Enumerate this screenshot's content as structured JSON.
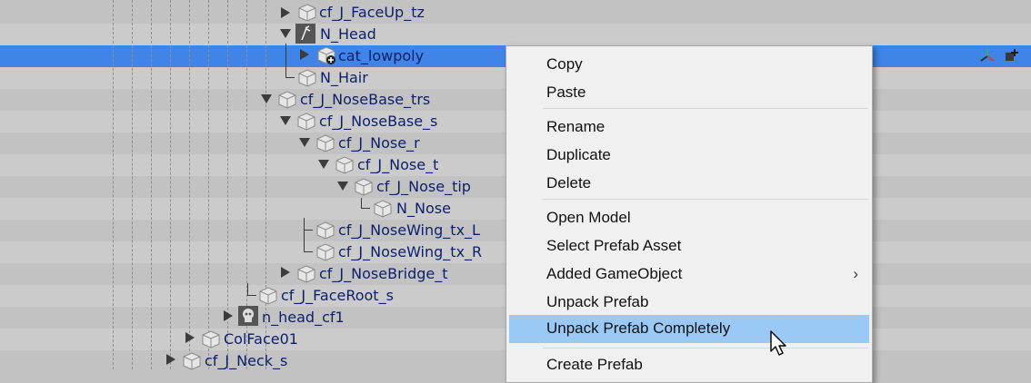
{
  "hierarchy": {
    "items": [
      {
        "label": "cf_J_FaceUp_tz"
      },
      {
        "label": "N_Head"
      },
      {
        "label": "cat_lowpoly"
      },
      {
        "label": "N_Hair"
      },
      {
        "label": "cf_J_NoseBase_trs"
      },
      {
        "label": "cf_J_NoseBase_s"
      },
      {
        "label": "cf_J_Nose_r"
      },
      {
        "label": "cf_J_Nose_t"
      },
      {
        "label": "cf_J_Nose_tip"
      },
      {
        "label": "N_Nose"
      },
      {
        "label": "cf_J_NoseWing_tx_L"
      },
      {
        "label": "cf_J_NoseWing_tx_R"
      },
      {
        "label": "cf_J_NoseBridge_t"
      },
      {
        "label": "cf_J_FaceRoot_s"
      },
      {
        "label": "n_head_cf1"
      },
      {
        "label": "ColFace01"
      },
      {
        "label": "cf_J_Neck_s"
      }
    ],
    "selected_item": "cat_lowpoly"
  },
  "context_menu": {
    "items": [
      {
        "label": "Copy"
      },
      {
        "label": "Paste"
      },
      {
        "label": "Rename"
      },
      {
        "label": "Duplicate"
      },
      {
        "label": "Delete"
      },
      {
        "label": "Open Model"
      },
      {
        "label": "Select Prefab Asset"
      },
      {
        "label": "Added GameObject",
        "submenu_icon": "chevron-right-icon"
      },
      {
        "label": "Unpack Prefab"
      },
      {
        "label": "Unpack Prefab Completely",
        "highlighted": true
      },
      {
        "label": "Create Prefab"
      }
    ]
  },
  "colors": {
    "row_odd": "#c2c2c2",
    "row_even": "#cbcbcb",
    "selection": "#3f84e6",
    "label_text": "#0c1f6b",
    "menu_bg": "#f0f0f0",
    "menu_highlight": "#9ac9f5"
  }
}
